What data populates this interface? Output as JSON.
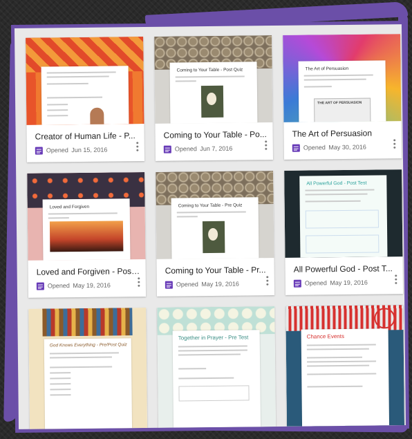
{
  "cards": [
    {
      "title": "Creator of Human Life - P...",
      "opened": "Opened",
      "date": "Jun 15, 2016",
      "thumb_title": "",
      "thumb_color": "#e8542a"
    },
    {
      "title": "Coming to Your Table - Po...",
      "opened": "Opened",
      "date": "Jun 7, 2016",
      "thumb_title": "Coming to Your Table - Post Quiz",
      "thumb_color": "#8a7f70"
    },
    {
      "title": "The Art of Persuasion",
      "opened": "Opened",
      "date": "May 30, 2016",
      "thumb_title": "The Art of Persuasion",
      "thumb_color": "#e23c6c",
      "thumb_image_text": "THE ART OF PERSUASION"
    },
    {
      "title": "Loved and Forgiven - Post...",
      "opened": "Opened",
      "date": "May 19, 2016",
      "thumb_title": "Loved and Forgiven",
      "thumb_color": "#3a3142"
    },
    {
      "title": "Coming to Your Table - Pr...",
      "opened": "Opened",
      "date": "May 19, 2016",
      "thumb_title": "Coming to Your Table - Pre Quiz",
      "thumb_color": "#8a7f70"
    },
    {
      "title": "All Powerful God - Post T...",
      "opened": "Opened",
      "date": "May 19, 2016",
      "thumb_title": "All Powerful God - Post Test",
      "thumb_color": "#1e2a2f"
    },
    {
      "title": "",
      "opened": "",
      "date": "",
      "thumb_title": "God Knows Everything - Pre/Post Quiz",
      "thumb_color": "#f2e3c0"
    },
    {
      "title": "",
      "opened": "",
      "date": "",
      "thumb_title": "Together in Prayer - Pre Test",
      "thumb_color": "#c9e4dc"
    },
    {
      "title": "",
      "opened": "",
      "date": "",
      "thumb_title": "Chance Events",
      "thumb_color": "#d7312f"
    }
  ]
}
